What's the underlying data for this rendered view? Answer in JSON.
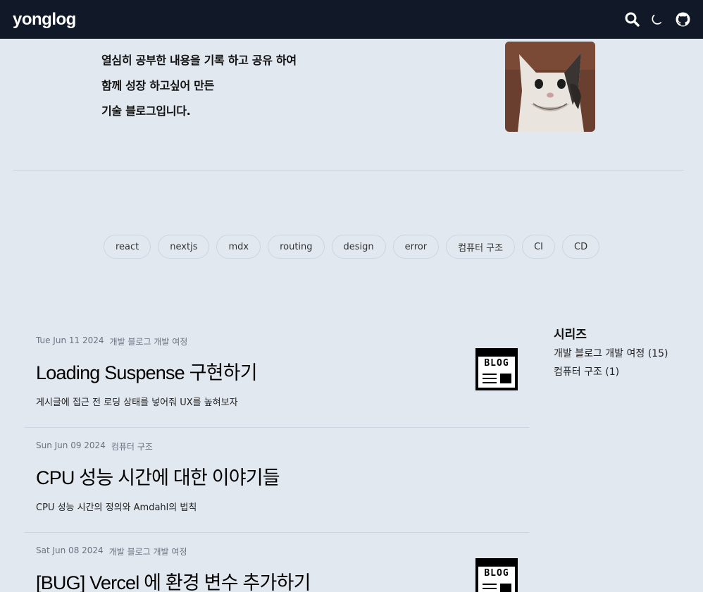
{
  "header": {
    "brand": "yonglog",
    "icons": [
      "search-icon",
      "moon-icon",
      "github-icon"
    ]
  },
  "intro": {
    "lines": [
      "열심히 공부한 내용을 기록 하고 공유 하여",
      "함께 성장 하고싶어 만든",
      "기술 블로그입니다."
    ]
  },
  "tags": [
    "react",
    "nextjs",
    "mdx",
    "routing",
    "design",
    "error",
    "컴퓨터 구조",
    "CI",
    "CD"
  ],
  "posts": [
    {
      "date": "Tue Jun 11 2024",
      "category": "개발 블로그 개발 여정",
      "title": "Loading Suspense 구현하기",
      "description": "게시글에 접근 전 로딩 상태를 넣어줘 UX를 높혀보자",
      "thumbnail_text": "BLOG"
    },
    {
      "date": "Sun Jun 09 2024",
      "category": "컴퓨터 구조",
      "title": "CPU 성능 시간에 대한 이야기들",
      "description": "CPU 성능 시간의 정의와 Amdahl의 법칙"
    },
    {
      "date": "Sat Jun 08 2024",
      "category": "개발 블로그 개발 여정",
      "title": "[BUG] Vercel 에 환경 변수 추가하기",
      "thumbnail_text": "BLOG"
    }
  ],
  "series": {
    "title": "시리즈",
    "items": [
      "개발 블로그 개발 여정 (15)",
      "컴퓨터 구조 (1)"
    ]
  },
  "colors": {
    "topbar": "#111827",
    "background": "#e2e8f0",
    "divider": "#cbd5e1"
  }
}
